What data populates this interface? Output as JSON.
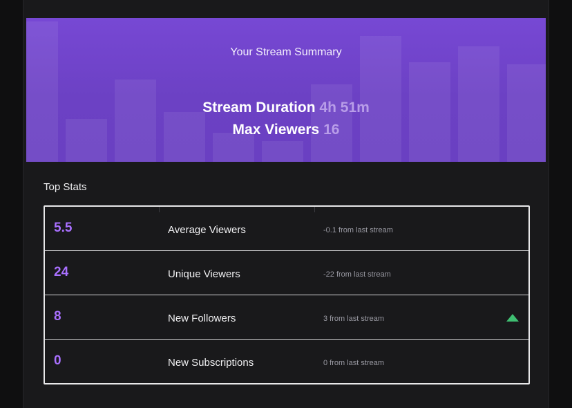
{
  "summary": {
    "title": "Your Stream Summary",
    "duration_label": "Stream Duration",
    "duration_value": "4h 51m",
    "max_viewers_label": "Max Viewers",
    "max_viewers_value": "16"
  },
  "top_stats": {
    "title": "Top Stats",
    "rows": [
      {
        "value": "5.5",
        "label": "Average Viewers",
        "change": "-0.1 from last stream",
        "trend": null
      },
      {
        "value": "24",
        "label": "Unique Viewers",
        "change": "-22 from last stream",
        "trend": null
      },
      {
        "value": "8",
        "label": "New Followers",
        "change": "3 from last stream",
        "trend": "up-arrow-icon"
      },
      {
        "value": "0",
        "label": "New Subscriptions",
        "change": "0 from last stream",
        "trend": null
      }
    ]
  },
  "colors": {
    "accent": "#a970ff",
    "banner": "#7748d4",
    "trend_up": "#3fbf72"
  }
}
